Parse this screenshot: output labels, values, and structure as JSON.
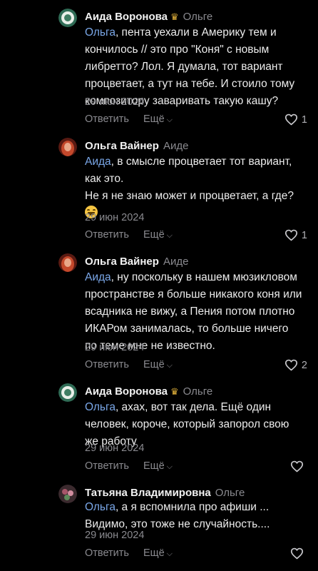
{
  "actions": {
    "reply_label": "Ответить",
    "more_label": "Ещё"
  },
  "comments": [
    {
      "author": "Аида Воронова",
      "has_crown": true,
      "reply_to": "Ольге",
      "mention": "Ольга",
      "text_lines": [
        ", пента уехали в Америку тем и",
        "кончилось // это про \"Коня\" с новым",
        "либретто? Лол. Я думала, тот вариант",
        "процветает, а тут на тебе. И стоило тому",
        "композитору заваривать такую кашу?"
      ],
      "date": "29 июн 2024",
      "likes": "1",
      "avatar": "avatar-aida"
    },
    {
      "author": "Ольга Вайнер",
      "has_crown": false,
      "reply_to": "Аиде",
      "mention": "Аида",
      "text_lines": [
        ", в смысле процветает тот вариант,",
        "как это.",
        "Не я не знаю может и процветает, а где?"
      ],
      "emoji": "grinning-sweat-emoji",
      "date": "29 июн 2024",
      "likes": "1",
      "avatar": "avatar-olga"
    },
    {
      "author": "Ольга Вайнер",
      "has_crown": false,
      "reply_to": "Аиде",
      "mention": "Аида",
      "text_lines": [
        ", ну поскольку в нашем мюзикловом",
        "пространстве я больше никакого коня или",
        "всадника не вижу, а Пения потом плотно",
        "ИКАРом занималась, то больше ничего",
        "по теме мне не известно."
      ],
      "date": "29 июн 2024",
      "likes": "2",
      "avatar": "avatar-olga"
    },
    {
      "author": "Аида Воронова",
      "has_crown": true,
      "reply_to": "Ольге",
      "mention": "Ольга",
      "text_lines": [
        ", ахах, вот так дела. Ещё один",
        "человек, короче, который запорол свою",
        "же работу"
      ],
      "date": "29 июн 2024",
      "likes": "",
      "avatar": "avatar-aida"
    },
    {
      "author": "Татьяна Владимировна",
      "has_crown": false,
      "reply_to": "Ольге",
      "mention": "Ольга",
      "text_lines": [
        ", а я вспомнила про афиши ...",
        "Видимо, это тоже не случайность...."
      ],
      "date": "29 июн 2024",
      "likes": "",
      "avatar": "avatar-tatiana"
    }
  ],
  "colors": {
    "background": "#000000",
    "mention": "#7aa7e8",
    "muted": "#8a8a8f",
    "crown": "#e6b53c"
  }
}
